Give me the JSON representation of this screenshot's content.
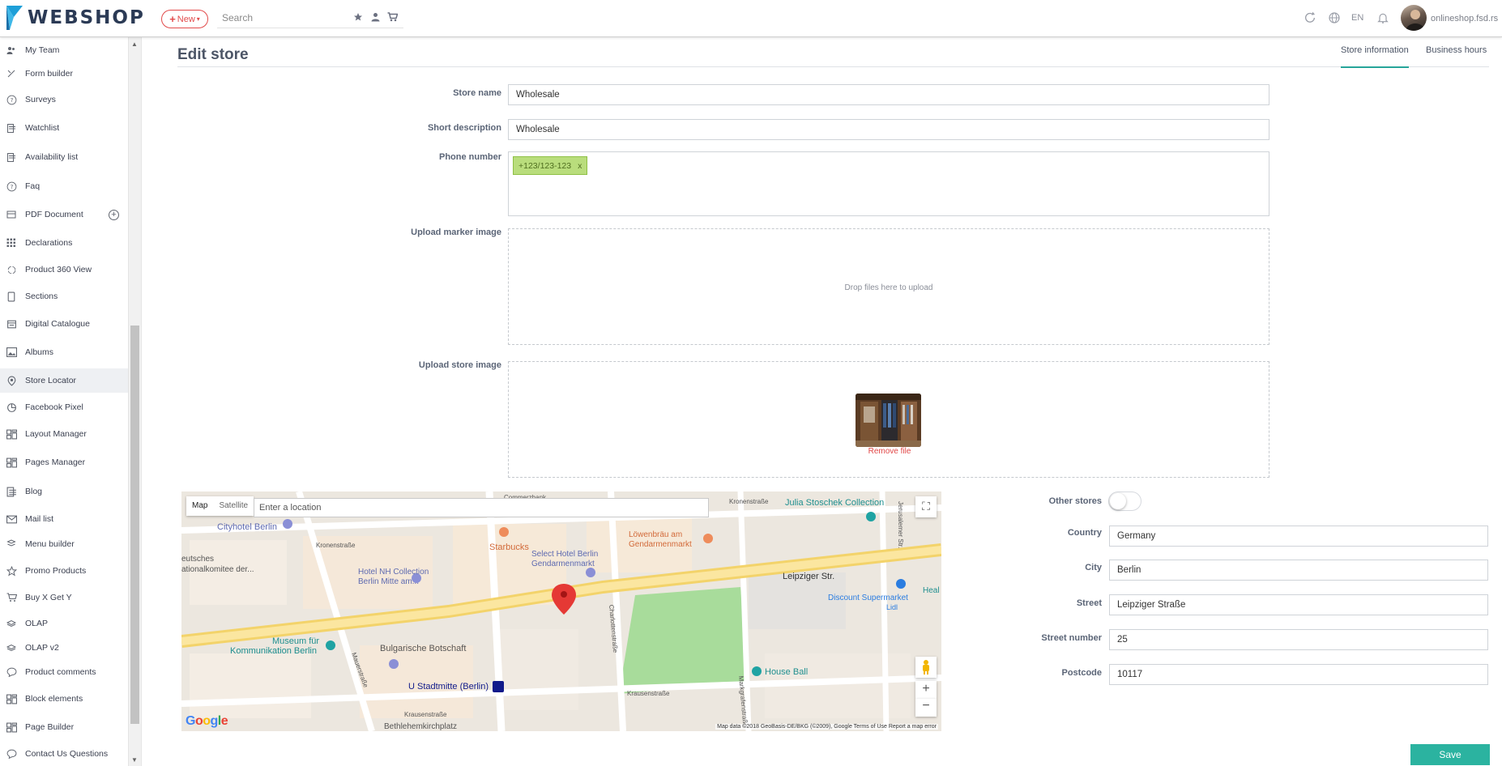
{
  "header": {
    "logo_text": "WEBSHOP",
    "new_button": "New",
    "search_placeholder": "Search",
    "language": "EN",
    "domain": "onlineshop.fsd.rs"
  },
  "sidebar": {
    "items": [
      {
        "label": "My Team",
        "icon": "team-icon"
      },
      {
        "label": "Form builder",
        "icon": "form-builder-icon"
      },
      {
        "label": "Surveys",
        "icon": "question-circle-icon"
      },
      {
        "label": "Watchlist",
        "icon": "watchlist-icon"
      },
      {
        "label": "Availability list",
        "icon": "availability-icon"
      },
      {
        "label": "Faq",
        "icon": "question-circle-icon"
      },
      {
        "label": "PDF Document",
        "icon": "pdf-icon"
      },
      {
        "label": "Declarations",
        "icon": "grid-icon"
      },
      {
        "label": "Product 360 View",
        "icon": "rotate-icon"
      },
      {
        "label": "Sections",
        "icon": "sections-icon"
      },
      {
        "label": "Digital Catalogue",
        "icon": "catalogue-icon"
      },
      {
        "label": "Albums",
        "icon": "image-icon"
      },
      {
        "label": "Store Locator",
        "icon": "store-locator-icon"
      },
      {
        "label": "Facebook Pixel",
        "icon": "pie-icon"
      },
      {
        "label": "Layout Manager",
        "icon": "layout-icon"
      },
      {
        "label": "Pages Manager",
        "icon": "layout-icon"
      },
      {
        "label": "Blog",
        "icon": "blog-icon"
      },
      {
        "label": "Mail list",
        "icon": "mail-icon"
      },
      {
        "label": "Menu builder",
        "icon": "menu-builder-icon"
      },
      {
        "label": "Promo Products",
        "icon": "star-icon"
      },
      {
        "label": "Buy X Get Y",
        "icon": "cart-icon"
      },
      {
        "label": "OLAP",
        "icon": "cube-icon"
      },
      {
        "label": "OLAP v2",
        "icon": "cube-icon"
      },
      {
        "label": "Product comments",
        "icon": "comment-icon"
      },
      {
        "label": "Block elements",
        "icon": "layout-icon"
      },
      {
        "label": "Page Builder",
        "icon": "layout-icon"
      },
      {
        "label": "Contact Us Questions",
        "icon": "chat-icon"
      }
    ],
    "active_index": 12
  },
  "page": {
    "title": "Edit store",
    "tabs": [
      "Store information",
      "Business hours"
    ],
    "active_tab": 0
  },
  "form": {
    "store_name_label": "Store name",
    "store_name": "Wholesale",
    "short_description_label": "Short description",
    "short_description": "Wholesale",
    "phone_label": "Phone number",
    "phone_tag": "+123/123-123",
    "tag_remove": "x",
    "marker_label": "Upload marker image",
    "dropzone_text": "Drop files here to upload",
    "store_image_label": "Upload store image",
    "remove_file": "Remove file",
    "other_stores_label": "Other stores",
    "country_label": "Country",
    "country": "Germany",
    "city_label": "City",
    "city": "Berlin",
    "street_label": "Street",
    "street": "Leipziger Straße",
    "street_number_label": "Street number",
    "street_number": "25",
    "postcode_label": "Postcode",
    "postcode": "10117"
  },
  "map": {
    "type_map": "Map",
    "type_satellite": "Satellite",
    "search_placeholder": "Enter a location",
    "footer": "Map data ©2018 GeoBasis-DE/BKG (©2009), Google   Terms of Use   Report a map error",
    "google": "Google",
    "labels": [
      "Cityhotel Berlin",
      "Starbucks",
      "Select Hotel Berlin Gendarmenmarkt",
      "Löwenbräu am Gendarmenmarkt",
      "Julia Stoschek Collection",
      "Leipziger Str.",
      "Hotel NH Collection Berlin Mitte am...",
      "Discount Supermarket",
      "Museum für Kommunikation Berlin",
      "Bulgarische Botschaft",
      "U Stadtmitte (Berlin)",
      "House Ball",
      "Kronenstraße",
      "Krausenstraße",
      "Bethlehemkirchplatz",
      "Deutsches Nationalkomitee der...",
      "Lidl",
      "Commerzbank",
      "Kronenstraße",
      "Mauerstraße",
      "Charlottenstraße",
      "Markgrafenstraße",
      "Jerusalemer Str.",
      "Krausenstraße",
      "Heal"
    ]
  },
  "actions": {
    "save": "Save"
  },
  "colors": {
    "accent": "#2bb3a0",
    "danger": "#e14848",
    "tag_bg": "#b9dd7c",
    "brand_blue": "#1e9fd8"
  }
}
